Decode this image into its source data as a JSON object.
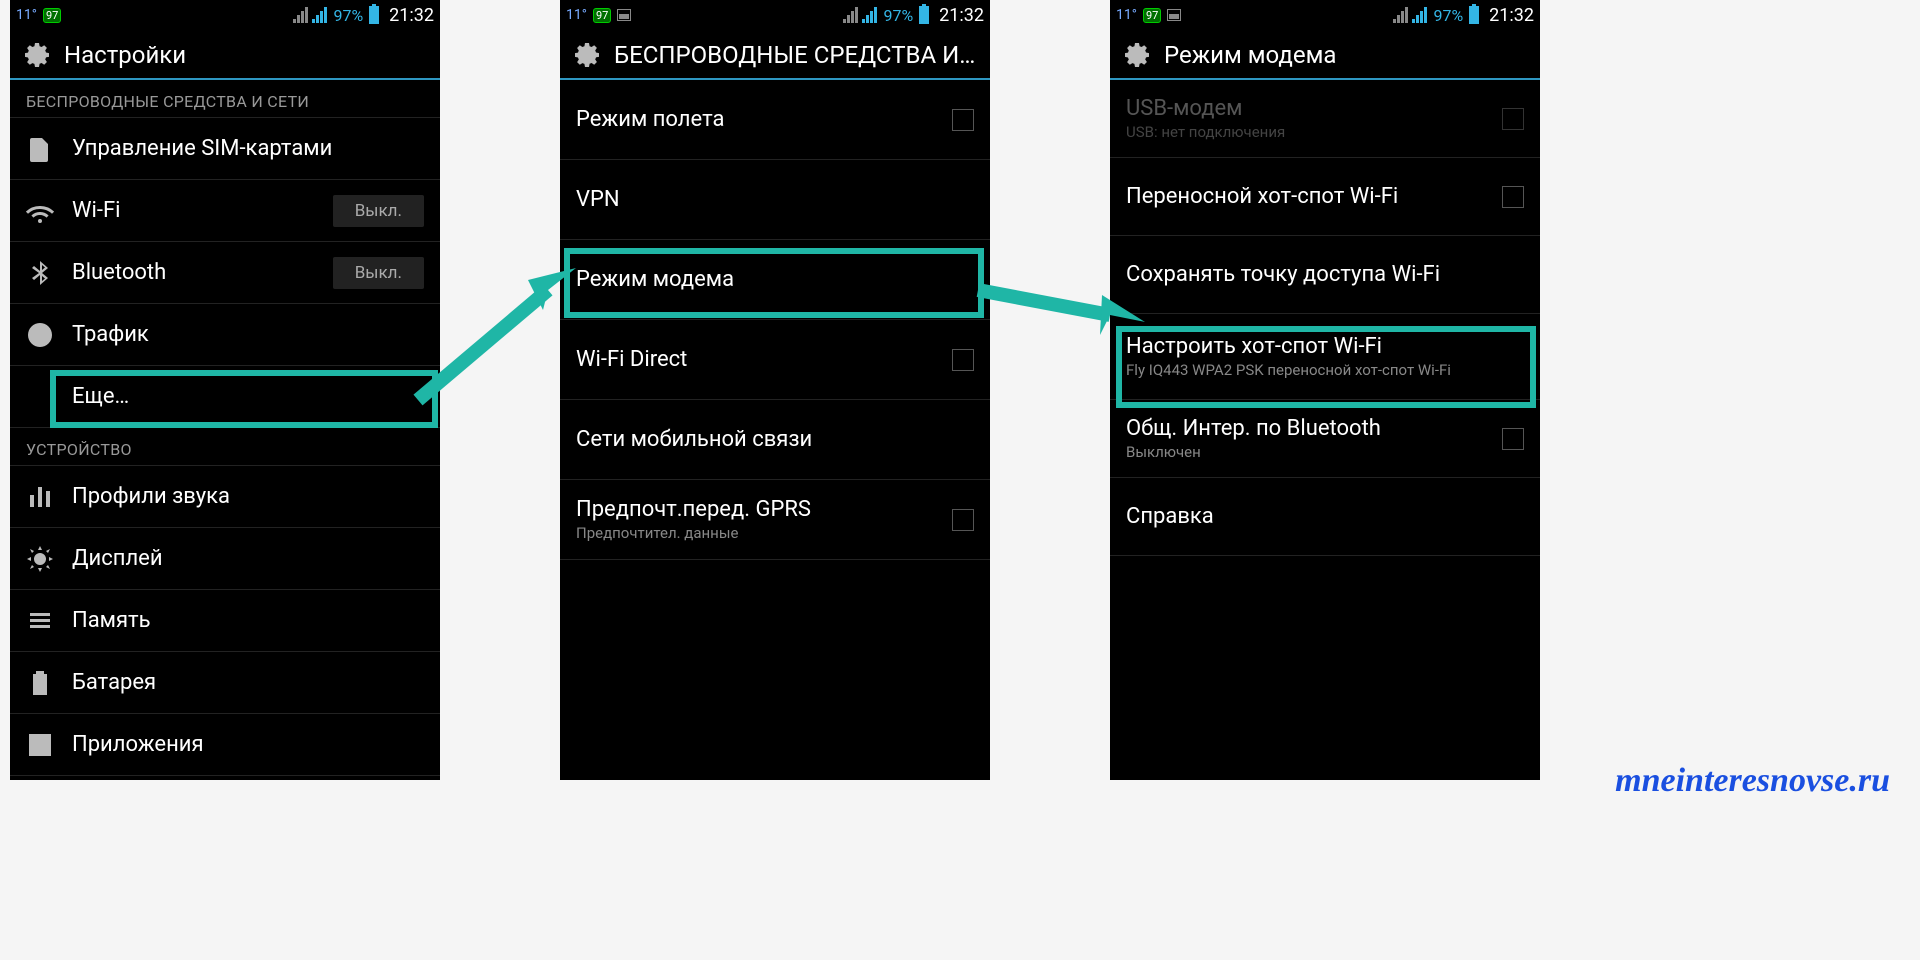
{
  "statusbar": {
    "temp": "11°",
    "battery_badge": "97",
    "battery_pct": "97%",
    "clock": "21:32"
  },
  "phone1": {
    "title": "Настройки",
    "section_wireless": "БЕСПРОВОДНЫЕ СРЕДСТВА И СЕТИ",
    "sim": "Управление SIM-картами",
    "wifi": "Wi-Fi",
    "wifi_state": "Выкл.",
    "bluetooth": "Bluetooth",
    "bluetooth_state": "Выкл.",
    "traffic": "Трафик",
    "more": "Еще…",
    "section_device": "УСТРОЙСТВО",
    "sound": "Профили звука",
    "display": "Дисплей",
    "storage": "Память",
    "battery": "Батарея",
    "apps": "Приложения"
  },
  "phone2": {
    "title": "БЕСПРОВОДНЫЕ СРЕДСТВА И СЕ…",
    "airplane": "Режим полета",
    "vpn": "VPN",
    "tether": "Режим модема",
    "wifi_direct": "Wi-Fi Direct",
    "mobile": "Сети мобильной связи",
    "gprs": "Предпочт.перед. GPRS",
    "gprs_sub": "Предпочтител. данные"
  },
  "phone3": {
    "title": "Режим модема",
    "usb": "USB-модем",
    "usb_sub": "USB: нет подключения",
    "hotspot": "Переносной хот-спот Wi-Fi",
    "save_ap": "Сохранять точку доступа Wi-Fi",
    "configure": "Настроить хот-спот Wi-Fi",
    "configure_sub": "Fly IQ443 WPA2 PSK переносной хот-спот Wi-Fi",
    "bt_share": "Общ. Интер. по Bluetooth",
    "bt_share_sub": "Выключен",
    "help": "Справка"
  },
  "watermark": "mneinteresnovse.ru"
}
